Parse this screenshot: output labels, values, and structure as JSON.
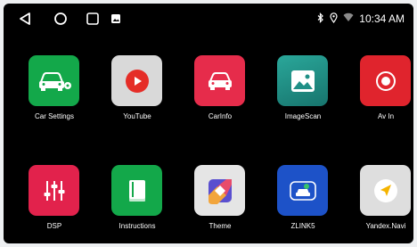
{
  "status_bar": {
    "time": "10:34 AM",
    "icons": [
      "bluetooth-icon",
      "location-icon",
      "wifi-icon"
    ]
  },
  "nav": {
    "icons": [
      "back-icon",
      "home-icon",
      "recents-icon",
      "screenshot-icon"
    ]
  },
  "apps": [
    {
      "label": "Car Settings",
      "icon": "car-settings-icon",
      "color": "#13a84a"
    },
    {
      "label": "YouTube",
      "icon": "youtube-icon",
      "color": "#d9d9d9"
    },
    {
      "label": "CarInfo",
      "icon": "car-info-icon",
      "color": "#e62c4b"
    },
    {
      "label": "ImageScan",
      "icon": "image-icon",
      "color": "#1f8f86"
    },
    {
      "label": "Av In",
      "icon": "record-icon",
      "color": "#e0242d"
    },
    {
      "label": "DSP",
      "icon": "equalizer-icon",
      "color": "#e2224c"
    },
    {
      "label": "Instructions",
      "icon": "book-icon",
      "color": "#13a84a"
    },
    {
      "label": "Theme",
      "icon": "theme-icon",
      "color": "#e5e5e5"
    },
    {
      "label": "ZLINK5",
      "icon": "zlink-icon",
      "color": "#1d52c8"
    },
    {
      "label": "Yandex.Navi",
      "icon": "navigator-icon",
      "color": "#dedede"
    }
  ]
}
